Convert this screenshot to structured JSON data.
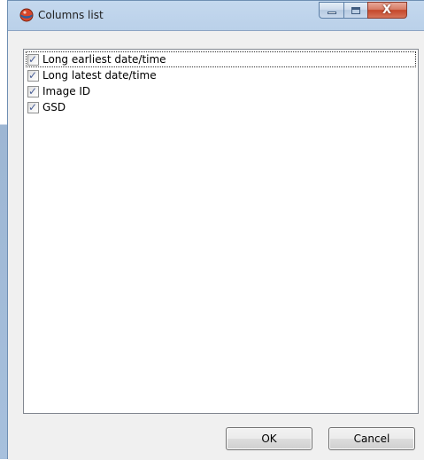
{
  "window": {
    "title": "Columns list",
    "close_glyph": "X"
  },
  "columns": {
    "items": [
      {
        "label": "Long earliest date/time",
        "checked": true
      },
      {
        "label": "Long latest date/time",
        "checked": true
      },
      {
        "label": "Image ID",
        "checked": true
      },
      {
        "label": "GSD",
        "checked": true
      }
    ],
    "check_glyph": "✓"
  },
  "buttons": {
    "ok_label": "OK",
    "cancel_label": "Cancel"
  },
  "icons": {
    "app": "app-icon",
    "minimize": "minimize-icon",
    "maximize": "maximize-icon",
    "close": "close-icon"
  },
  "colors": {
    "title_bar": "#b8cfe8",
    "close_button": "#c5462a",
    "dialog_face": "#f0f0f0",
    "checkmark": "#4a5f97"
  }
}
